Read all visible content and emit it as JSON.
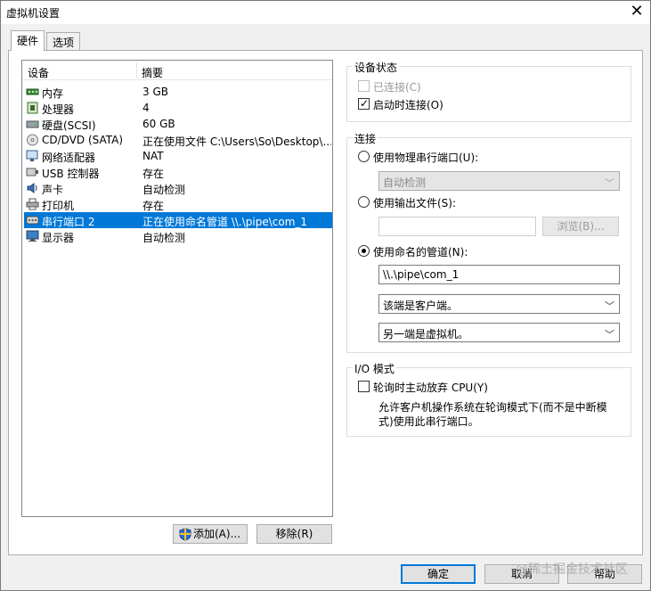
{
  "window": {
    "title": "虚拟机设置",
    "close": "✕"
  },
  "tabs": [
    {
      "label": "硬件",
      "active": true
    },
    {
      "label": "选项",
      "active": false
    }
  ],
  "device_list": {
    "headers": {
      "device": "设备",
      "summary": "摘要"
    },
    "rows": [
      {
        "name": "内存",
        "summary": "3 GB",
        "icon": "memory-icon",
        "selected": false
      },
      {
        "name": "处理器",
        "summary": "4",
        "icon": "processor-icon",
        "selected": false
      },
      {
        "name": "硬盘(SCSI)",
        "summary": "60 GB",
        "icon": "harddisk-icon",
        "selected": false
      },
      {
        "name": "CD/DVD (SATA)",
        "summary": "正在使用文件 C:\\Users\\So\\Desktop\\...",
        "icon": "cd-icon",
        "selected": false
      },
      {
        "name": "网络适配器",
        "summary": "NAT",
        "icon": "network-icon",
        "selected": false
      },
      {
        "name": "USB 控制器",
        "summary": "存在",
        "icon": "usb-icon",
        "selected": false
      },
      {
        "name": "声卡",
        "summary": "自动检测",
        "icon": "sound-icon",
        "selected": false
      },
      {
        "name": "打印机",
        "summary": "存在",
        "icon": "printer-icon",
        "selected": false
      },
      {
        "name": "串行端口 2",
        "summary": "正在使用命名管道 \\\\.\\pipe\\com_1",
        "icon": "serial-port-icon",
        "selected": true
      },
      {
        "name": "显示器",
        "summary": "自动检测",
        "icon": "display-icon",
        "selected": false
      }
    ]
  },
  "buttons": {
    "add": "添加(A)...",
    "remove": "移除(R)",
    "ok": "确定",
    "cancel": "取消",
    "help": "帮助"
  },
  "device_status": {
    "title": "设备状态",
    "connected": {
      "label": "已连接(C)",
      "checked": false,
      "disabled": true
    },
    "connect_at_power_on": {
      "label": "启动时连接(O)",
      "checked": true
    }
  },
  "connection": {
    "title": "连接",
    "physical_port": {
      "label": "使用物理串行端口(U):",
      "selected": false,
      "dropdown_value": "自动检测"
    },
    "output_file": {
      "label": "使用输出文件(S):",
      "selected": false,
      "value": "",
      "browse_label": "浏览(B)..."
    },
    "named_pipe": {
      "label": "使用命名的管道(N):",
      "selected": true,
      "value": "\\\\.\\pipe\\com_1",
      "end_option": "该端是客户端。",
      "other_end_option": "另一端是虚拟机。"
    }
  },
  "io_mode": {
    "title": "I/O 模式",
    "yield_cpu": {
      "label": "轮询时主动放弃 CPU(Y)",
      "checked": false
    },
    "description": "允许客户机操作系统在轮询模式下(而不是中断模式)使用此串行端口。"
  },
  "watermark": "@稀土掘金技术社区",
  "colors": {
    "selection": "#0078d7",
    "default_button_border": "#0078d7"
  }
}
